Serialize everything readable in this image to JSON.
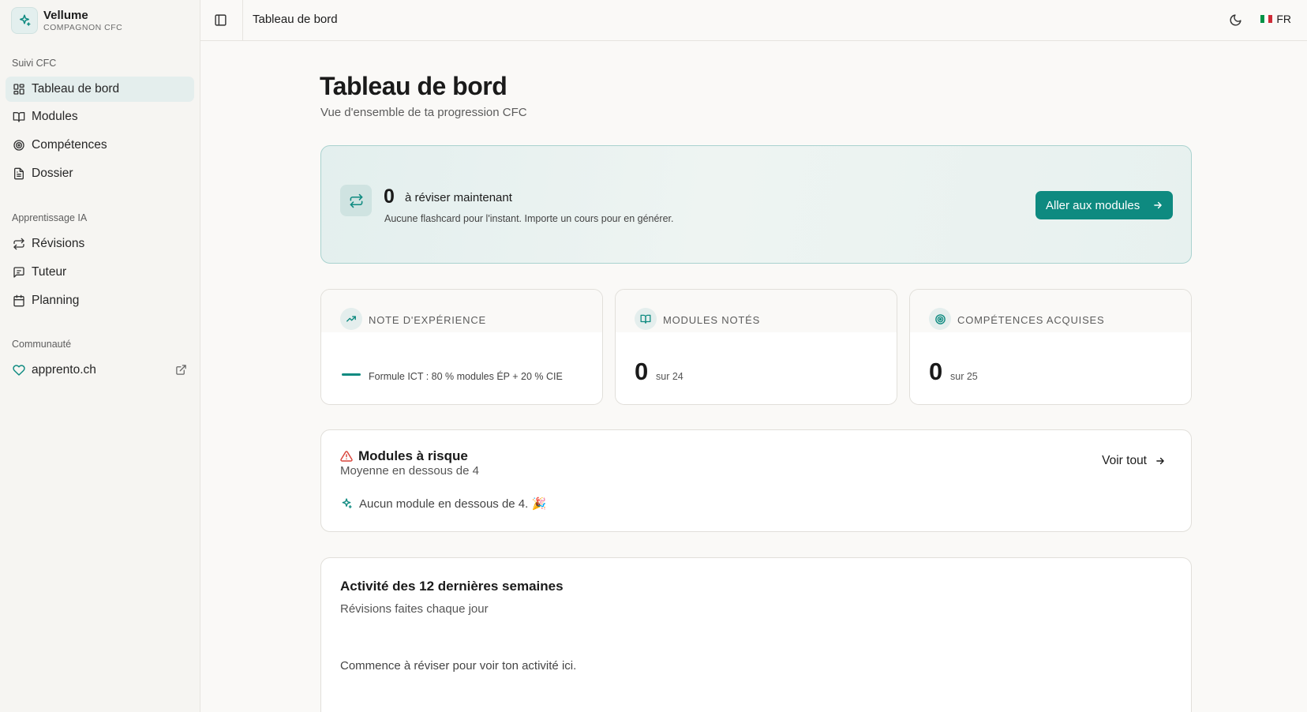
{
  "app": {
    "name": "Vellume",
    "subtitle": "COMPAGNON CFC"
  },
  "sidebar": {
    "sections": [
      {
        "label": "Suivi CFC",
        "items": [
          {
            "label": "Tableau de bord",
            "icon": "dashboard-icon",
            "active": true
          },
          {
            "label": "Modules",
            "icon": "book-icon"
          },
          {
            "label": "Compétences",
            "icon": "target-icon"
          },
          {
            "label": "Dossier",
            "icon": "document-icon"
          }
        ]
      },
      {
        "label": "Apprentissage IA",
        "items": [
          {
            "label": "Révisions",
            "icon": "repeat-icon"
          },
          {
            "label": "Tuteur",
            "icon": "chat-icon"
          },
          {
            "label": "Planning",
            "icon": "calendar-icon"
          }
        ]
      },
      {
        "label": "Communauté",
        "items": [
          {
            "label": "apprento.ch",
            "icon": "heart-icon",
            "external": true
          }
        ]
      }
    ]
  },
  "topbar": {
    "title": "Tableau de bord",
    "language": "FR"
  },
  "page": {
    "title": "Tableau de bord",
    "subtitle": "Vue d'ensemble de ta progression CFC"
  },
  "review": {
    "count": "0",
    "label": "à réviser maintenant",
    "note": "Aucune flashcard pour l'instant. Importe un cours pour en générer.",
    "button": "Aller aux modules"
  },
  "stats": {
    "experience": {
      "label": "NOTE D'EXPÉRIENCE",
      "formula": "Formule ICT : 80 % modules ÉP + 20 % CIE"
    },
    "modules": {
      "label": "MODULES NOTÉS",
      "value": "0",
      "of": "sur 24"
    },
    "skills": {
      "label": "COMPÉTENCES ACQUISES",
      "value": "0",
      "of": "sur 25"
    }
  },
  "risk": {
    "title": "Modules à risque",
    "subtitle": "Moyenne en dessous de 4",
    "see_all": "Voir tout",
    "empty": "Aucun module en dessous de 4. 🎉"
  },
  "activity": {
    "title": "Activité des 12 dernières semaines",
    "subtitle": "Révisions faites chaque jour",
    "empty": "Commence à réviser pour voir ton activité ici."
  },
  "colors": {
    "accent": "#0e8a80",
    "accent_soft": "#e4eeed",
    "danger": "#d9453b"
  }
}
